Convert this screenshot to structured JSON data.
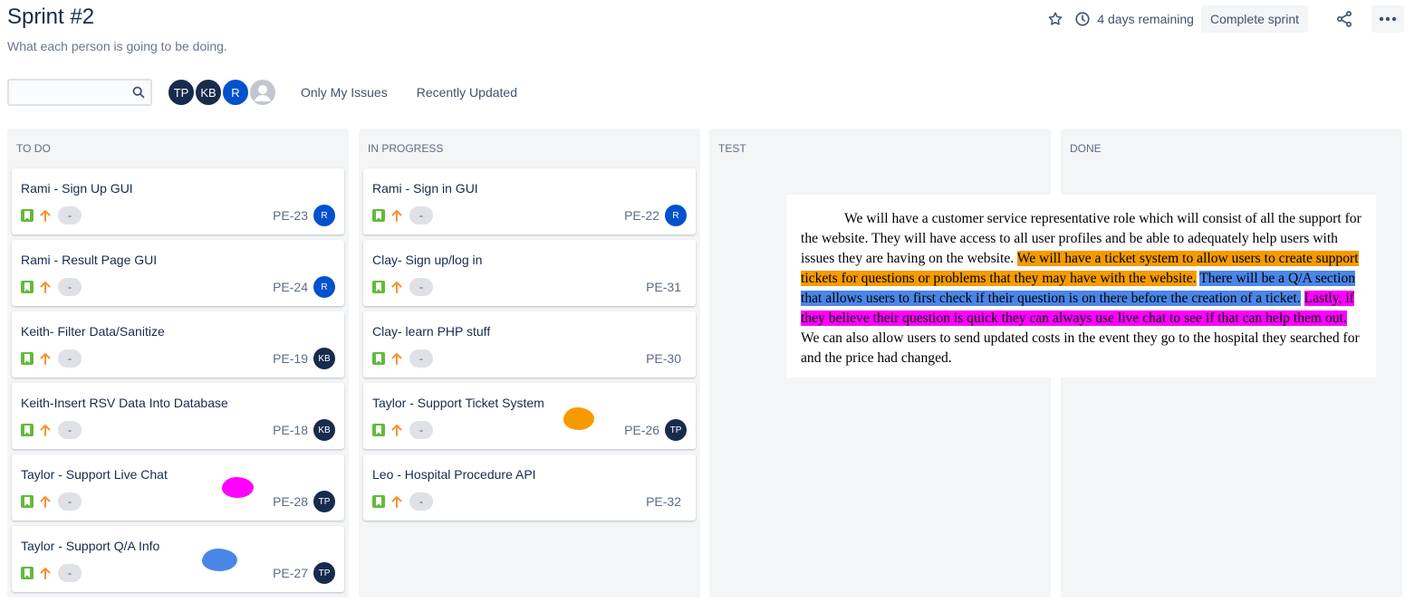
{
  "header": {
    "title": "Sprint #2",
    "subtitle": "What each person is going to be doing.",
    "remaining": "4 days remaining",
    "complete_label": "Complete sprint",
    "icons": [
      "star-icon",
      "clock-icon",
      "share-icon",
      "more-icon"
    ]
  },
  "toolbar": {
    "search_value": "",
    "avatars": [
      {
        "initials": "TP",
        "color": "#172b4d"
      },
      {
        "initials": "KB",
        "color": "#172b4d"
      },
      {
        "initials": "R",
        "color": "#0052cc"
      },
      {
        "initials": "",
        "color": "#c1c7d0"
      }
    ],
    "filters": [
      "Only My Issues",
      "Recently Updated"
    ]
  },
  "colors": {
    "story_green": "#63ba3c",
    "priority_orange": "#f79232",
    "avatar_navy": "#172b4d",
    "avatar_blue": "#0052cc"
  },
  "columns": [
    {
      "title": "TO DO",
      "cards": [
        {
          "title": "Rami - Sign Up GUI",
          "estimate": "-",
          "key": "PE-23",
          "assignee": "R"
        },
        {
          "title": "Rami - Result Page GUI",
          "estimate": "-",
          "key": "PE-24",
          "assignee": "R"
        },
        {
          "title": "Keith- Filter Data/Sanitize",
          "estimate": "-",
          "key": "PE-19",
          "assignee": "KB"
        },
        {
          "title": "Keith-Insert RSV Data Into Database",
          "estimate": "-",
          "key": "PE-18",
          "assignee": "KB"
        },
        {
          "title": "Taylor - Support Live Chat",
          "estimate": "-",
          "key": "PE-28",
          "assignee": "TP"
        },
        {
          "title": "Taylor - Support Q/A Info",
          "estimate": "-",
          "key": "PE-27",
          "assignee": "TP"
        }
      ]
    },
    {
      "title": "IN PROGRESS",
      "cards": [
        {
          "title": "Rami - Sign in GUI",
          "estimate": "-",
          "key": "PE-22",
          "assignee": "R"
        },
        {
          "title": "Clay- Sign up/log in",
          "estimate": "-",
          "key": "PE-31",
          "assignee": ""
        },
        {
          "title": "Clay- learn PHP stuff",
          "estimate": "-",
          "key": "PE-30",
          "assignee": ""
        },
        {
          "title": "Taylor - Support Ticket System",
          "estimate": "-",
          "key": "PE-26",
          "assignee": "TP"
        },
        {
          "title": "Leo - Hospital Procedure API",
          "estimate": "-",
          "key": "PE-32",
          "assignee": ""
        }
      ]
    },
    {
      "title": "TEST",
      "cards": []
    },
    {
      "title": "DONE",
      "cards": []
    }
  ],
  "overlay": {
    "plain1": "We will have a customer service representative role which will consist of all the support for the website. They will have access to all user profiles and be able to adequately help users with issues they are having on the website. ",
    "orange": "We will have a ticket system to allow users to create support tickets for questions or problems that they may have with the website.",
    "blue": "There will be a Q/A section that allows users to first check if their question is on there before the creation of a ticket.",
    "magenta": "Lastly, if they believe their question is quick they can always use live chat to see if that can help them out.",
    "plain2": " We can also allow users to send updated costs in the event they go to the hospital they searched for and the price had changed."
  }
}
